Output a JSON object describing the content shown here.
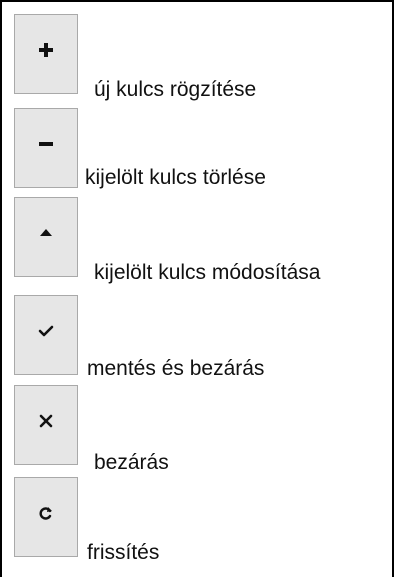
{
  "toolbar": {
    "items": [
      {
        "icon": "plus-icon",
        "label": "új kulcs rögzítése"
      },
      {
        "icon": "minus-icon",
        "label": "kijelölt kulcs törlése"
      },
      {
        "icon": "triangle-up-icon",
        "label": "kijelölt kulcs módosítása"
      },
      {
        "icon": "checkmark-icon",
        "label": "mentés és bezárás"
      },
      {
        "icon": "close-icon",
        "label": "bezárás"
      },
      {
        "icon": "refresh-icon",
        "label": "frissítés"
      }
    ]
  },
  "colors": {
    "button_bg": "#e6e6e6",
    "button_border": "#a9a9a9",
    "frame": "#000000",
    "text": "#111111"
  }
}
